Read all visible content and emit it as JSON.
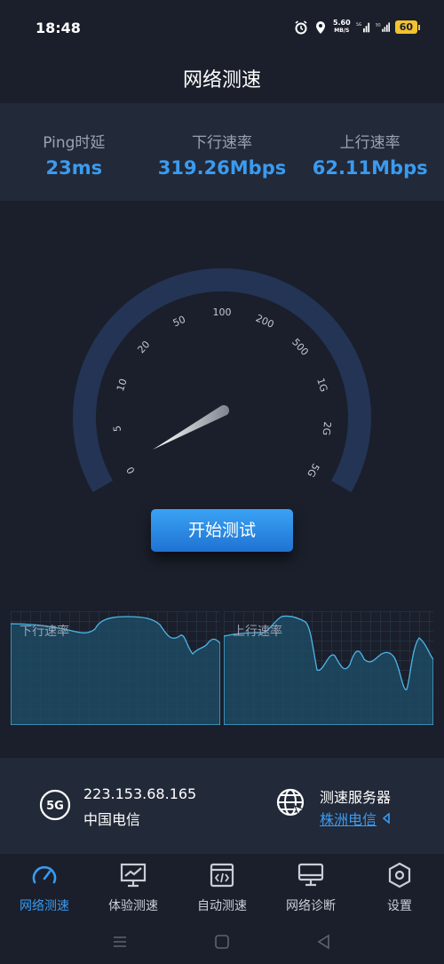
{
  "status_bar": {
    "time": "18:48",
    "net_speed_top": "5.60",
    "net_speed_bottom": "MB/S",
    "battery": "60"
  },
  "page": {
    "title": "网络测速"
  },
  "stats": {
    "ping_label": "Ping时延",
    "ping_value": "23ms",
    "download_label": "下行速率",
    "download_value": "319.26Mbps",
    "upload_label": "上行速率",
    "upload_value": "62.11Mbps"
  },
  "gauge": {
    "ticks": [
      "0",
      "5",
      "10",
      "20",
      "50",
      "100",
      "200",
      "500",
      "1G",
      "2G",
      "5G"
    ],
    "needle_level": 0.0
  },
  "start_button": {
    "label": "开始测试"
  },
  "charts": {
    "download_label": "下行速率",
    "upload_label": "上行速率"
  },
  "info": {
    "network_badge": "5G",
    "ip": "223.153.68.165",
    "isp": "中国电信",
    "server_title": "测速服务器",
    "server_name": "株洲电信"
  },
  "nav": {
    "items": [
      {
        "label": "网络测速",
        "icon": "speedometer-icon",
        "active": true
      },
      {
        "label": "体验测速",
        "icon": "monitor-chart-icon",
        "active": false
      },
      {
        "label": "自动测速",
        "icon": "code-window-icon",
        "active": false
      },
      {
        "label": "网络诊断",
        "icon": "computer-icon",
        "active": false
      },
      {
        "label": "设置",
        "icon": "hexagon-settings-icon",
        "active": false
      }
    ]
  },
  "colors": {
    "background": "#1a1f2b",
    "panel": "#222938",
    "accent": "#3a9bf0",
    "gauge_arc": "#243455"
  }
}
